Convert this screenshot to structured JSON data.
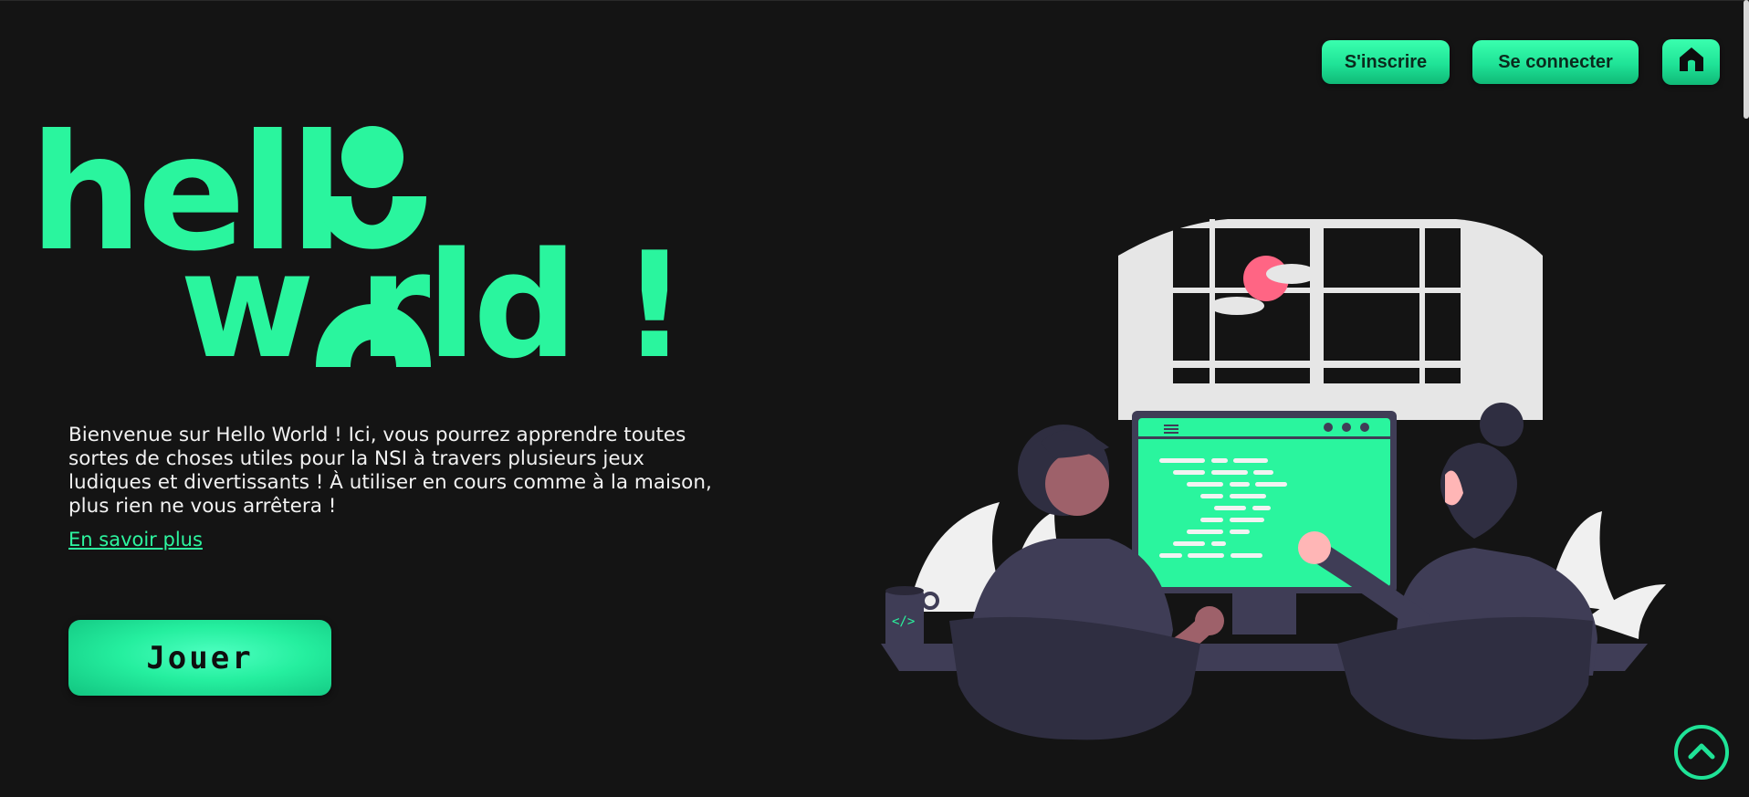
{
  "nav": {
    "signup_label": "S'inscrire",
    "login_label": "Se connecter",
    "home_icon": "home-icon"
  },
  "logo": {
    "line1": "hell",
    "line2": "w rld !"
  },
  "intro": {
    "text": "Bienvenue sur Hello World ! Ici, vous pourrez apprendre toutes sortes de choses utiles pour la NSI à travers plusieurs jeux ludiques et divertissants ! À utiliser en cours comme à la maison, plus rien ne vous arrêtera !",
    "more_link": "En savoir plus"
  },
  "play_button": {
    "label": "Jouer"
  },
  "scroll_top": {
    "icon": "chevron-up-icon"
  },
  "colors": {
    "accent": "#2af59e",
    "background": "#141414",
    "text": "#f2f2f2"
  }
}
